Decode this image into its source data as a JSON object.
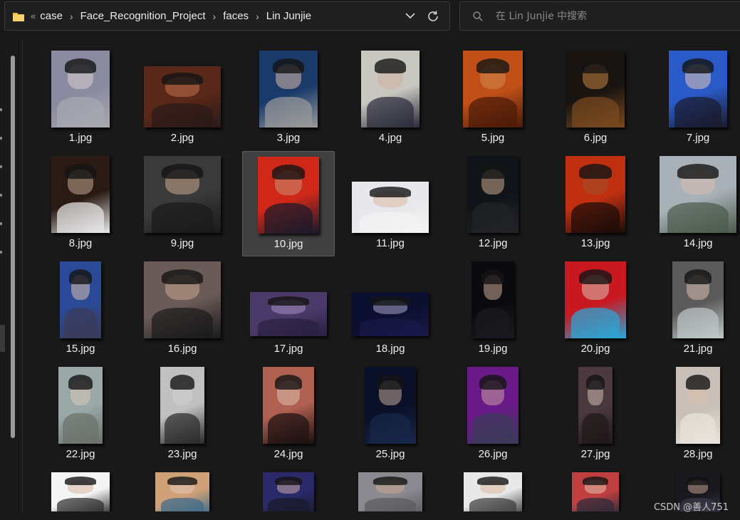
{
  "address_bar": {
    "overflow_label": "«",
    "path": [
      "case",
      "Face_Recognition_Project",
      "faces",
      "Lin Junjie"
    ],
    "separator": "›"
  },
  "search": {
    "placeholder": "在 Lin Junjie 中搜索"
  },
  "files": [
    {
      "name": "1.jpg",
      "colors": [
        "#8a8aa0",
        "#d8d0cc",
        "#a8a8b0"
      ]
    },
    {
      "name": "2.jpg",
      "colors": [
        "#5a2818",
        "#c07050",
        "#2a1a18"
      ]
    },
    {
      "name": "3.jpg",
      "colors": [
        "#1a3a6a",
        "#d8b8a8",
        "#9a9a9a"
      ]
    },
    {
      "name": "4.jpg",
      "colors": [
        "#c8c8c0",
        "#d0b0a0",
        "#2a2a3a"
      ]
    },
    {
      "name": "5.jpg",
      "colors": [
        "#c05018",
        "#d08850",
        "#4a1a08"
      ]
    },
    {
      "name": "6.jpg",
      "colors": [
        "#1a1410",
        "#c08040",
        "#7a4a20"
      ]
    },
    {
      "name": "7.jpg",
      "colors": [
        "#2a5ac8",
        "#e0c8b8",
        "#1a1a2a"
      ]
    },
    {
      "name": "8.jpg",
      "colors": [
        "#2a1a14",
        "#c0a890",
        "#eaeaea"
      ]
    },
    {
      "name": "9.jpg",
      "colors": [
        "#3a3a3a",
        "#c8a890",
        "#1a1a1a"
      ]
    },
    {
      "name": "10.jpg",
      "colors": [
        "#d02818",
        "#c89078",
        "#1a1a2a"
      ]
    },
    {
      "name": "11.jpg",
      "colors": [
        "#e8e8ec",
        "#d8b8a0",
        "#f4f4f4"
      ]
    },
    {
      "name": "12.jpg",
      "colors": [
        "#101418",
        "#c8a890",
        "#222428"
      ]
    },
    {
      "name": "13.jpg",
      "colors": [
        "#c03010",
        "#a05030",
        "#1a0c08"
      ]
    },
    {
      "name": "14.jpg",
      "colors": [
        "#a8b0b8",
        "#d8c0b0",
        "#4a5a4a"
      ]
    },
    {
      "name": "15.jpg",
      "colors": [
        "#2a4a98",
        "#d8c0b0",
        "#3a3a58"
      ]
    },
    {
      "name": "16.jpg",
      "colors": [
        "#6a5a58",
        "#c8a890",
        "#1a1a1a"
      ]
    },
    {
      "name": "17.jpg",
      "colors": [
        "#4a3a6a",
        "#a890c0",
        "#2a2040"
      ]
    },
    {
      "name": "18.jpg",
      "colors": [
        "#0c1030",
        "#a8a0c8",
        "#181848"
      ]
    },
    {
      "name": "19.jpg",
      "colors": [
        "#0a0a0e",
        "#c8a898",
        "#1a1a20"
      ]
    },
    {
      "name": "20.jpg",
      "colors": [
        "#c81820",
        "#d8c0b0",
        "#28a8d8"
      ]
    },
    {
      "name": "21.jpg",
      "colors": [
        "#5a5a5a",
        "#d8c0b0",
        "#c0c8c8"
      ]
    },
    {
      "name": "22.jpg",
      "colors": [
        "#9aa8a8",
        "#d8c8b8",
        "#6a706a"
      ]
    },
    {
      "name": "23.jpg",
      "colors": [
        "#c0c0c0",
        "#d0d0d0",
        "#2a2a2a"
      ]
    },
    {
      "name": "24.jpg",
      "colors": [
        "#b06050",
        "#e0c0b0",
        "#1a1010"
      ]
    },
    {
      "name": "25.jpg",
      "colors": [
        "#0a1028",
        "#c0a898",
        "#18284a"
      ]
    },
    {
      "name": "26.jpg",
      "colors": [
        "#6a1a88",
        "#c8a0a0",
        "#3a3a58"
      ]
    },
    {
      "name": "27.jpg",
      "colors": [
        "#4a3a40",
        "#d0b8b0",
        "#201818"
      ]
    },
    {
      "name": "28.jpg",
      "colors": [
        "#c8c0b8",
        "#d8c0a8",
        "#eae4dc"
      ]
    },
    {
      "name": "",
      "colors": [
        "#f4f4f4",
        "#d8b8a8",
        "#2a2a2a"
      ]
    },
    {
      "name": "",
      "colors": [
        "#d0a078",
        "#e0c8b8",
        "#3a6a8a"
      ]
    },
    {
      "name": "",
      "colors": [
        "#2a2a6a",
        "#c8a8a8",
        "#1a1a2a"
      ]
    },
    {
      "name": "",
      "colors": [
        "#8a8a90",
        "#c8a890",
        "#5a5a60"
      ]
    },
    {
      "name": "",
      "colors": [
        "#e8e8e8",
        "#d8b8a0",
        "#3a3a3a"
      ]
    },
    {
      "name": "",
      "colors": [
        "#c04040",
        "#e0c0a8",
        "#2a2a3a"
      ]
    },
    {
      "name": "",
      "colors": [
        "#18181e",
        "#c0a090",
        "#3a3a4a"
      ]
    }
  ],
  "selected_file": "10.jpg",
  "watermark": "CSDN @善人751"
}
